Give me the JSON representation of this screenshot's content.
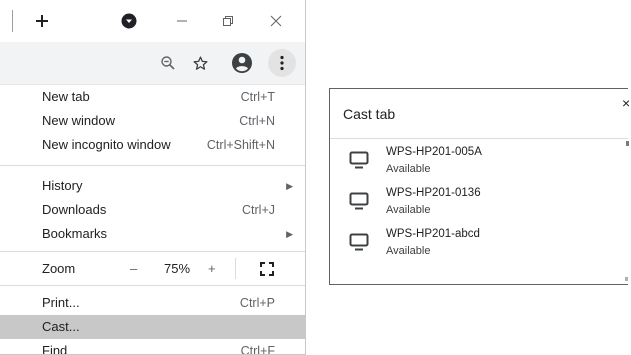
{
  "window": {
    "new_tab_icon": "plus-icon",
    "profile_icon": "chevron-down-circle-icon",
    "minimize_icon": "minimize-icon",
    "restore_icon": "restore-icon",
    "close_label": "✕"
  },
  "toolbar": {
    "zoom_icon": "zoom-out-magnifier-icon",
    "bookmark_icon": "star-icon",
    "account_icon": "account-icon",
    "menu_icon": "kebab-menu-icon"
  },
  "menu": {
    "new_tab": {
      "label": "New tab",
      "shortcut": "Ctrl+T"
    },
    "new_window": {
      "label": "New window",
      "shortcut": "Ctrl+N"
    },
    "new_incognito": {
      "label": "New incognito window",
      "shortcut": "Ctrl+Shift+N"
    },
    "history": {
      "label": "History"
    },
    "downloads": {
      "label": "Downloads",
      "shortcut": "Ctrl+J"
    },
    "bookmarks": {
      "label": "Bookmarks"
    },
    "zoom": {
      "label": "Zoom",
      "minus": "–",
      "value": "75%",
      "plus": "+"
    },
    "print": {
      "label": "Print...",
      "shortcut": "Ctrl+P"
    },
    "cast": {
      "label": "Cast..."
    },
    "find": {
      "label": "Find",
      "shortcut": "Ctrl+F"
    }
  },
  "cast_dialog": {
    "title": "Cast tab",
    "close": "×",
    "devices": [
      {
        "name": "WPS-HP201-005A",
        "status": "Available"
      },
      {
        "name": "WPS-HP201-0136",
        "status": "Available"
      },
      {
        "name": "WPS-HP201-abcd",
        "status": "Available"
      }
    ]
  },
  "colors": {
    "highlight": "#c8c8c8",
    "toolbar_bg": "#f1f3f4",
    "text": "#202124",
    "icon": "#5f6368"
  }
}
